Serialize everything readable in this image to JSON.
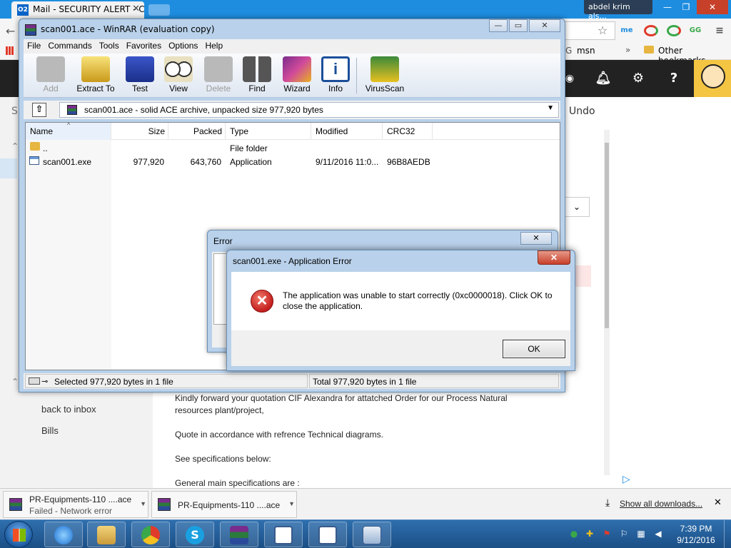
{
  "browser": {
    "tabs": [
      {
        "label": "Mail - SECURITY ALERT - C",
        "favicon": "O2"
      }
    ],
    "profile_name": "abdel krim als...",
    "bookmarks": {
      "msn": "msn",
      "more": "»",
      "other": "Other bookmarks"
    },
    "extensions": [
      "me",
      "GG"
    ]
  },
  "ymail": {
    "undo_label": "Undo",
    "left_links": [
      "back to inbox",
      "Bills"
    ],
    "email_lines": [
      "Kindly forward your quotation CIF Alexandra for attatched Order for our Process Natural resources plant/project,",
      "Quote in accordance with refrence Technical diagrams.",
      "See specifications below:",
      "General main specifications are :"
    ]
  },
  "winrar": {
    "title": "scan001.ace - WinRAR (evaluation copy)",
    "menu": [
      "File",
      "Commands",
      "Tools",
      "Favorites",
      "Options",
      "Help"
    ],
    "toolbar": [
      {
        "label": "Add",
        "icon": "add-icon",
        "enabled": false
      },
      {
        "label": "Extract To",
        "icon": "extract-to-icon",
        "enabled": true
      },
      {
        "label": "Test",
        "icon": "test-icon",
        "enabled": true
      },
      {
        "label": "View",
        "icon": "view-icon",
        "enabled": true
      },
      {
        "label": "Delete",
        "icon": "delete-icon",
        "enabled": false
      },
      {
        "label": "Find",
        "icon": "find-icon",
        "enabled": true
      },
      {
        "label": "Wizard",
        "icon": "wizard-icon",
        "enabled": true
      },
      {
        "label": "Info",
        "icon": "info-icon",
        "enabled": true
      },
      {
        "label": "VirusScan",
        "icon": "virusscan-icon",
        "enabled": true
      }
    ],
    "path_text": "scan001.ace - solid ACE archive, unpacked size 977,920 bytes",
    "columns": [
      "Name",
      "Size",
      "Packed",
      "Type",
      "Modified",
      "CRC32"
    ],
    "rows": [
      {
        "name": "..",
        "size": "",
        "packed": "",
        "type": "File folder",
        "modified": "",
        "crc": ""
      },
      {
        "name": "scan001.exe",
        "size": "977,920",
        "packed": "643,760",
        "type": "Application",
        "modified": "9/11/2016 11:0...",
        "crc": "96B8AEDB"
      }
    ],
    "status_left": "Selected 977,920 bytes in 1 file",
    "status_right": "Total 977,920 bytes in 1 file"
  },
  "error_dialog": {
    "title": "Error"
  },
  "app_error": {
    "title": "scan001.exe - Application Error",
    "message": "The application was unable to start correctly (0xc0000018). Click OK to close the application.",
    "ok_label": "OK"
  },
  "downloads": [
    {
      "name": "PR-Equipments-110 ....ace",
      "status": "Failed - Network error"
    },
    {
      "name": "PR-Equipments-110 ....ace",
      "status": ""
    }
  ],
  "show_all_downloads": "Show all downloads...",
  "taskbar": {
    "time": "7:39 PM",
    "date": "9/12/2016",
    "pinned": [
      "ie-icon",
      "explorer-icon",
      "chrome-icon",
      "skype-icon",
      "winrar-icon",
      "app-window-icon",
      "app-window-icon-2",
      "window-icon"
    ]
  },
  "colors": {
    "accent": "#1e8de0",
    "dialog_frame": "#b9d1ea",
    "error_red": "#c41e1e"
  }
}
